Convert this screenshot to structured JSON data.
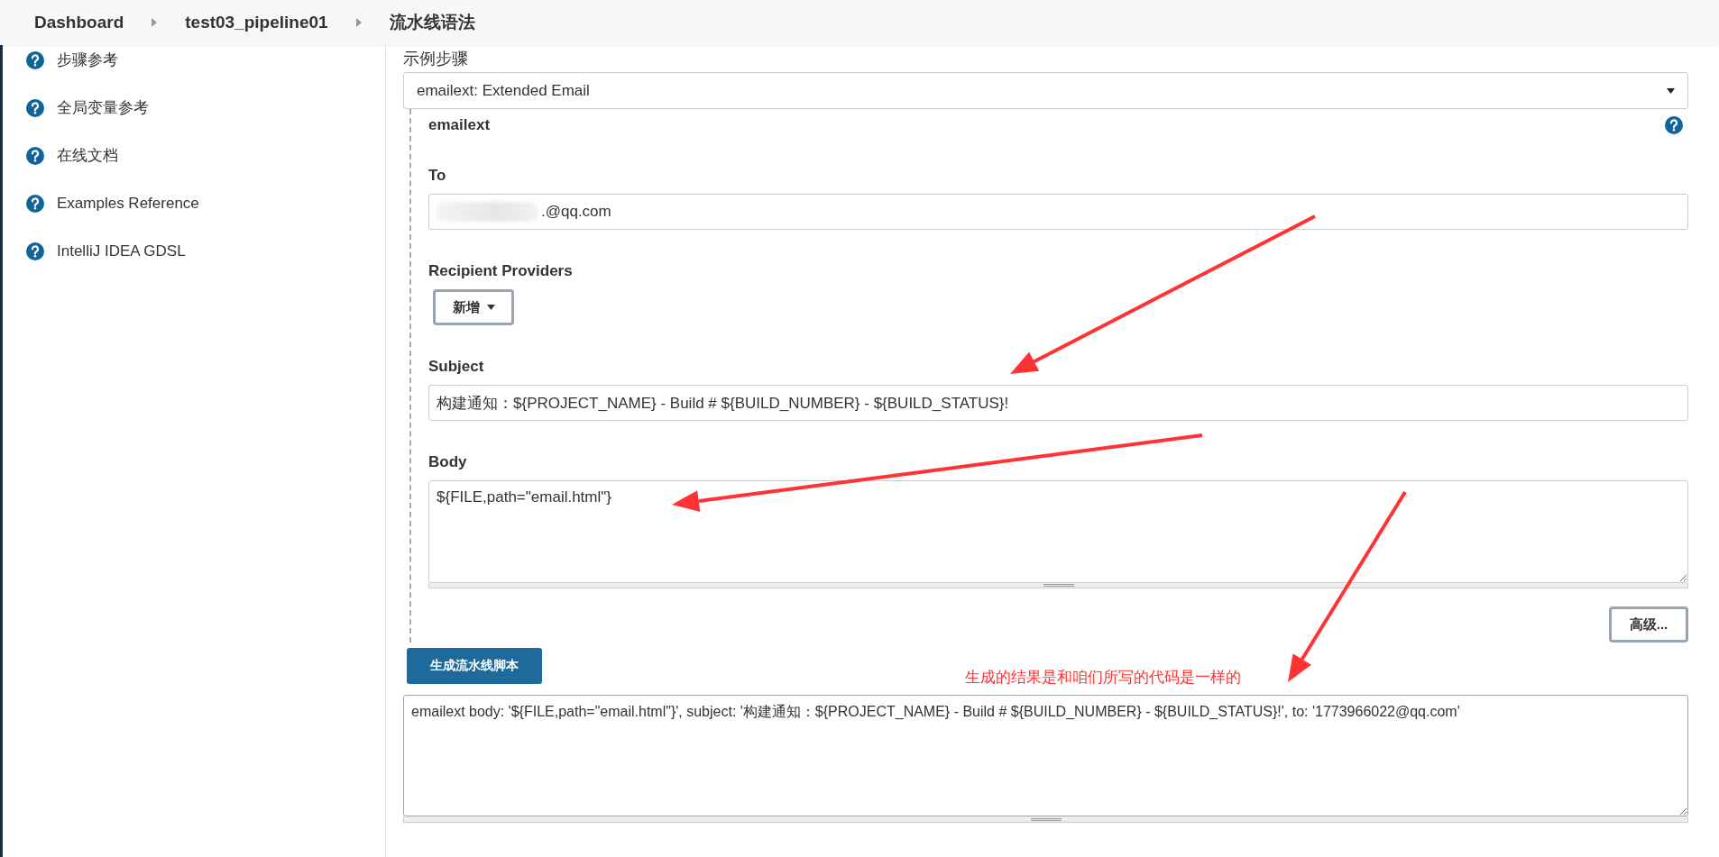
{
  "breadcrumbs": [
    {
      "label": "Dashboard"
    },
    {
      "label": "test03_pipeline01"
    },
    {
      "label": "流水线语法"
    }
  ],
  "sidebar": {
    "items": [
      {
        "label": "步骤参考"
      },
      {
        "label": "全局变量参考"
      },
      {
        "label": "在线文档"
      },
      {
        "label": "Examples Reference"
      },
      {
        "label": "IntelliJ IDEA GDSL"
      }
    ]
  },
  "step": {
    "label": "示例步骤",
    "select_value": "emailext: Extended Email",
    "title": "emailext",
    "fields": [
      {
        "kind": "text",
        "label": "To",
        "value": ".@qq.com",
        "redacted": true
      },
      {
        "kind": "dropdown",
        "label": "Recipient Providers",
        "button": "新增"
      },
      {
        "kind": "text",
        "label": "Subject",
        "value": "构建通知：${PROJECT_NAME} - Build # ${BUILD_NUMBER} - ${BUILD_STATUS}!"
      },
      {
        "kind": "textarea",
        "label": "Body",
        "value": "${FILE,path=\"email.html\"}"
      }
    ],
    "advanced_button": "高级..."
  },
  "generate_button": "生成流水线脚本",
  "annotation": "生成的结果是和咱们所写的代码是一样的",
  "output": "emailext body: '${FILE,path=\"email.html\"}', subject: '构建通知：${PROJECT_NAME} - Build # ${BUILD_NUMBER} - ${BUILD_STATUS}!', to: '1773966022@qq.com'"
}
